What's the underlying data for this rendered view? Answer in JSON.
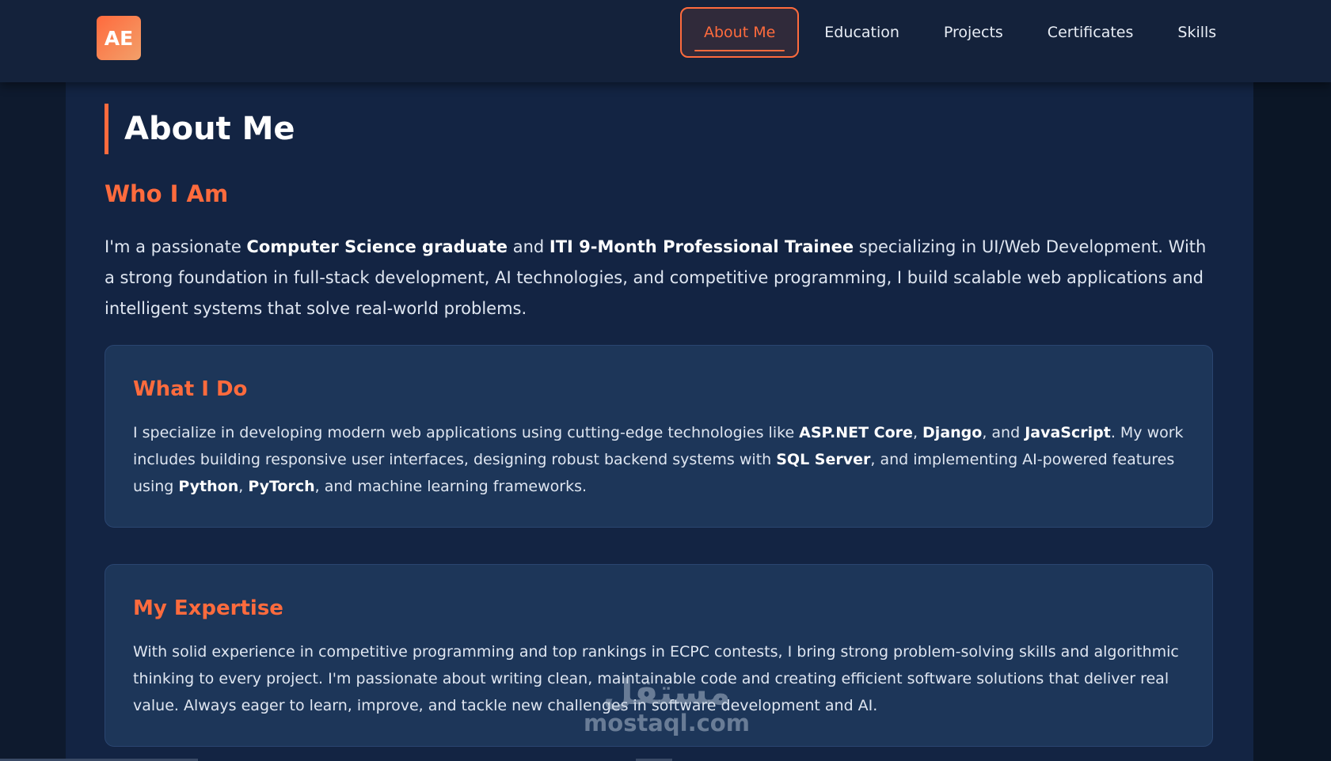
{
  "logo": {
    "text": "AE"
  },
  "nav": {
    "items": [
      {
        "label": "About Me",
        "active": true
      },
      {
        "label": "Education",
        "active": false
      },
      {
        "label": "Projects",
        "active": false
      },
      {
        "label": "Certificates",
        "active": false
      },
      {
        "label": "Skills",
        "active": false
      }
    ]
  },
  "page": {
    "title": "About Me",
    "who_heading": "Who I Am",
    "intro": {
      "t1": "I'm a passionate ",
      "b1": "Computer Science graduate",
      "t2": " and ",
      "b2": "ITI 9-Month Professional Trainee",
      "t3": " specializing in UI/Web Development. With a strong foundation in full-stack development, AI technologies, and competitive programming, I build scalable web applications and intelligent systems that solve real-world problems."
    }
  },
  "cards": {
    "what_i_do": {
      "title": "What I Do",
      "t1": "I specialize in developing modern web applications using cutting-edge technologies like ",
      "b1": "ASP.NET Core",
      "t2": ", ",
      "b2": "Django",
      "t3": ", and ",
      "b3": "JavaScript",
      "t4": ". My work includes building responsive user interfaces, designing robust backend systems with ",
      "b4": "SQL Server",
      "t5": ", and implementing AI-powered features using ",
      "b5": "Python",
      "t6": ", ",
      "b6": "PyTorch",
      "t7": ", and machine learning frameworks."
    },
    "my_expertise": {
      "title": "My Expertise",
      "body": "With solid experience in competitive programming and top rankings in ECPC contests, I bring strong problem-solving skills and algorithmic thinking to every project. I'm passionate about writing clean, maintainable code and creating efficient software solutions that deliver real value. Always eager to learn, improve, and tackle new challenges in software development and AI."
    }
  },
  "watermark": {
    "arabic": "مستقل",
    "latin": "mostaql.com"
  },
  "colors": {
    "accent": "#ff6b3d",
    "nav_bg": "#14223b",
    "content_bg": "#132443",
    "card_bg": "#1d3659"
  }
}
